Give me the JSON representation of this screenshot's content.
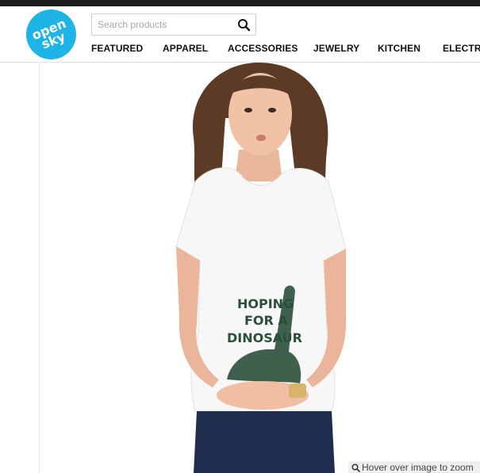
{
  "brand": {
    "name": "open sky",
    "color": "#1fb4e6"
  },
  "search": {
    "placeholder": "Search products",
    "icon": "search-icon"
  },
  "nav": {
    "items": [
      {
        "label": "FEATURED"
      },
      {
        "label": "APPAREL"
      },
      {
        "label": "ACCESSORIES"
      },
      {
        "label": "JEWELRY"
      },
      {
        "label": "KITCHEN"
      },
      {
        "label": "ELECTRO"
      }
    ]
  },
  "product": {
    "shirt_text": "HOPING\nFOR A\nDINOSAUR",
    "zoom_hint": "Hover over image to zoom",
    "zoom_icon": "magnifier-icon"
  }
}
